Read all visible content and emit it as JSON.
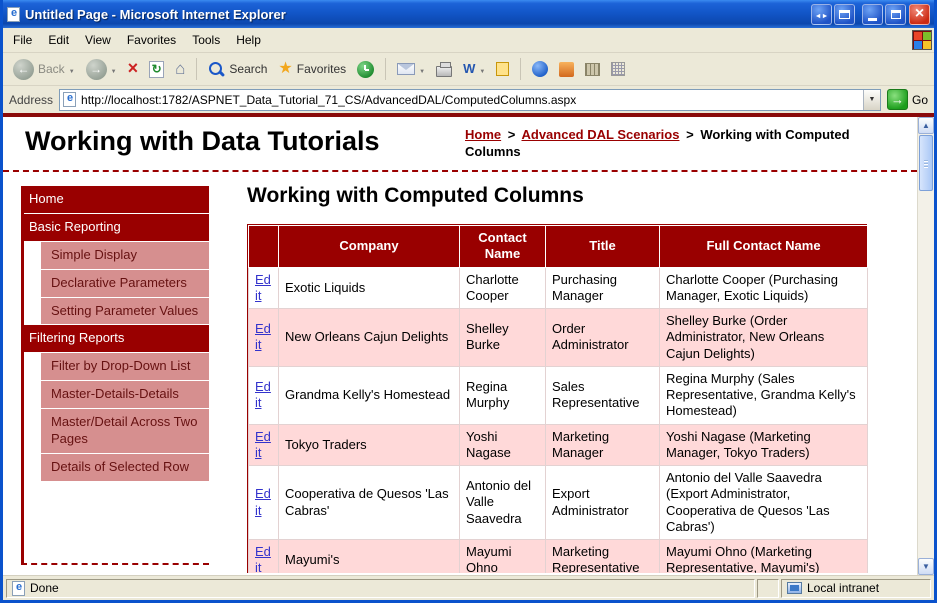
{
  "window": {
    "title": "Untitled Page - Microsoft Internet Explorer"
  },
  "menu": {
    "items": [
      "File",
      "Edit",
      "View",
      "Favorites",
      "Tools",
      "Help"
    ]
  },
  "toolbar": {
    "back_label": "Back",
    "search_label": "Search",
    "favorites_label": "Favorites"
  },
  "address": {
    "label": "Address",
    "url": "http://localhost:1782/ASPNET_Data_Tutorial_71_CS/AdvancedDAL/ComputedColumns.aspx",
    "go_label": "Go"
  },
  "page": {
    "site_title": "Working with Data Tutorials",
    "heading": "Working with Computed Columns",
    "breadcrumb": {
      "separator": ">",
      "items": [
        {
          "label": "Home"
        },
        {
          "label": "Advanced DAL Scenarios"
        },
        {
          "label": "Working with Computed Columns"
        }
      ]
    }
  },
  "sidebar": {
    "items": [
      {
        "label": "Home",
        "type": "section"
      },
      {
        "label": "Basic Reporting",
        "type": "section"
      },
      {
        "label": "Simple Display",
        "type": "sub"
      },
      {
        "label": "Declarative Parameters",
        "type": "sub"
      },
      {
        "label": "Setting Parameter Values",
        "type": "sub"
      },
      {
        "label": "Filtering Reports",
        "type": "section"
      },
      {
        "label": "Filter by Drop-Down List",
        "type": "sub"
      },
      {
        "label": "Master-Details-Details",
        "type": "sub"
      },
      {
        "label": "Master/Detail Across Two Pages",
        "type": "sub"
      },
      {
        "label": "Details of Selected Row",
        "type": "sub"
      }
    ]
  },
  "grid": {
    "edit_label": "Edit",
    "columns": [
      "Company",
      "Contact Name",
      "Title",
      "Full Contact Name"
    ],
    "rows": [
      {
        "company": "Exotic Liquids",
        "contact": "Charlotte Cooper",
        "title": "Purchasing Manager",
        "full": "Charlotte Cooper (Purchasing Manager, Exotic Liquids)"
      },
      {
        "company": "New Orleans Cajun Delights",
        "contact": "Shelley Burke",
        "title": "Order Administrator",
        "full": "Shelley Burke (Order Administrator, New Orleans Cajun Delights)"
      },
      {
        "company": "Grandma Kelly's Homestead",
        "contact": "Regina Murphy",
        "title": "Sales Representative",
        "full": "Regina Murphy (Sales Representative, Grandma Kelly's Homestead)"
      },
      {
        "company": "Tokyo Traders",
        "contact": "Yoshi Nagase",
        "title": "Marketing Manager",
        "full": "Yoshi Nagase (Marketing Manager, Tokyo Traders)"
      },
      {
        "company": "Cooperativa de Quesos 'Las Cabras'",
        "contact": "Antonio del Valle Saavedra",
        "title": "Export Administrator",
        "full": "Antonio del Valle Saavedra (Export Administrator, Cooperativa de Quesos 'Las Cabras')"
      },
      {
        "company": "Mayumi's",
        "contact": "Mayumi Ohno",
        "title": "Marketing Representative",
        "full": "Mayumi Ohno (Marketing Representative, Mayumi's)"
      }
    ]
  },
  "status": {
    "done": "Done",
    "zone": "Local intranet"
  },
  "colors": {
    "accent_maroon": "#990000",
    "sidebar_sub_bg": "#d68f8f",
    "alt_row_pink": "#ffd9d9",
    "titlebar_blue": "#1256c8",
    "link_blue": "#3333cc",
    "chrome_tan": "#ece9d8"
  }
}
